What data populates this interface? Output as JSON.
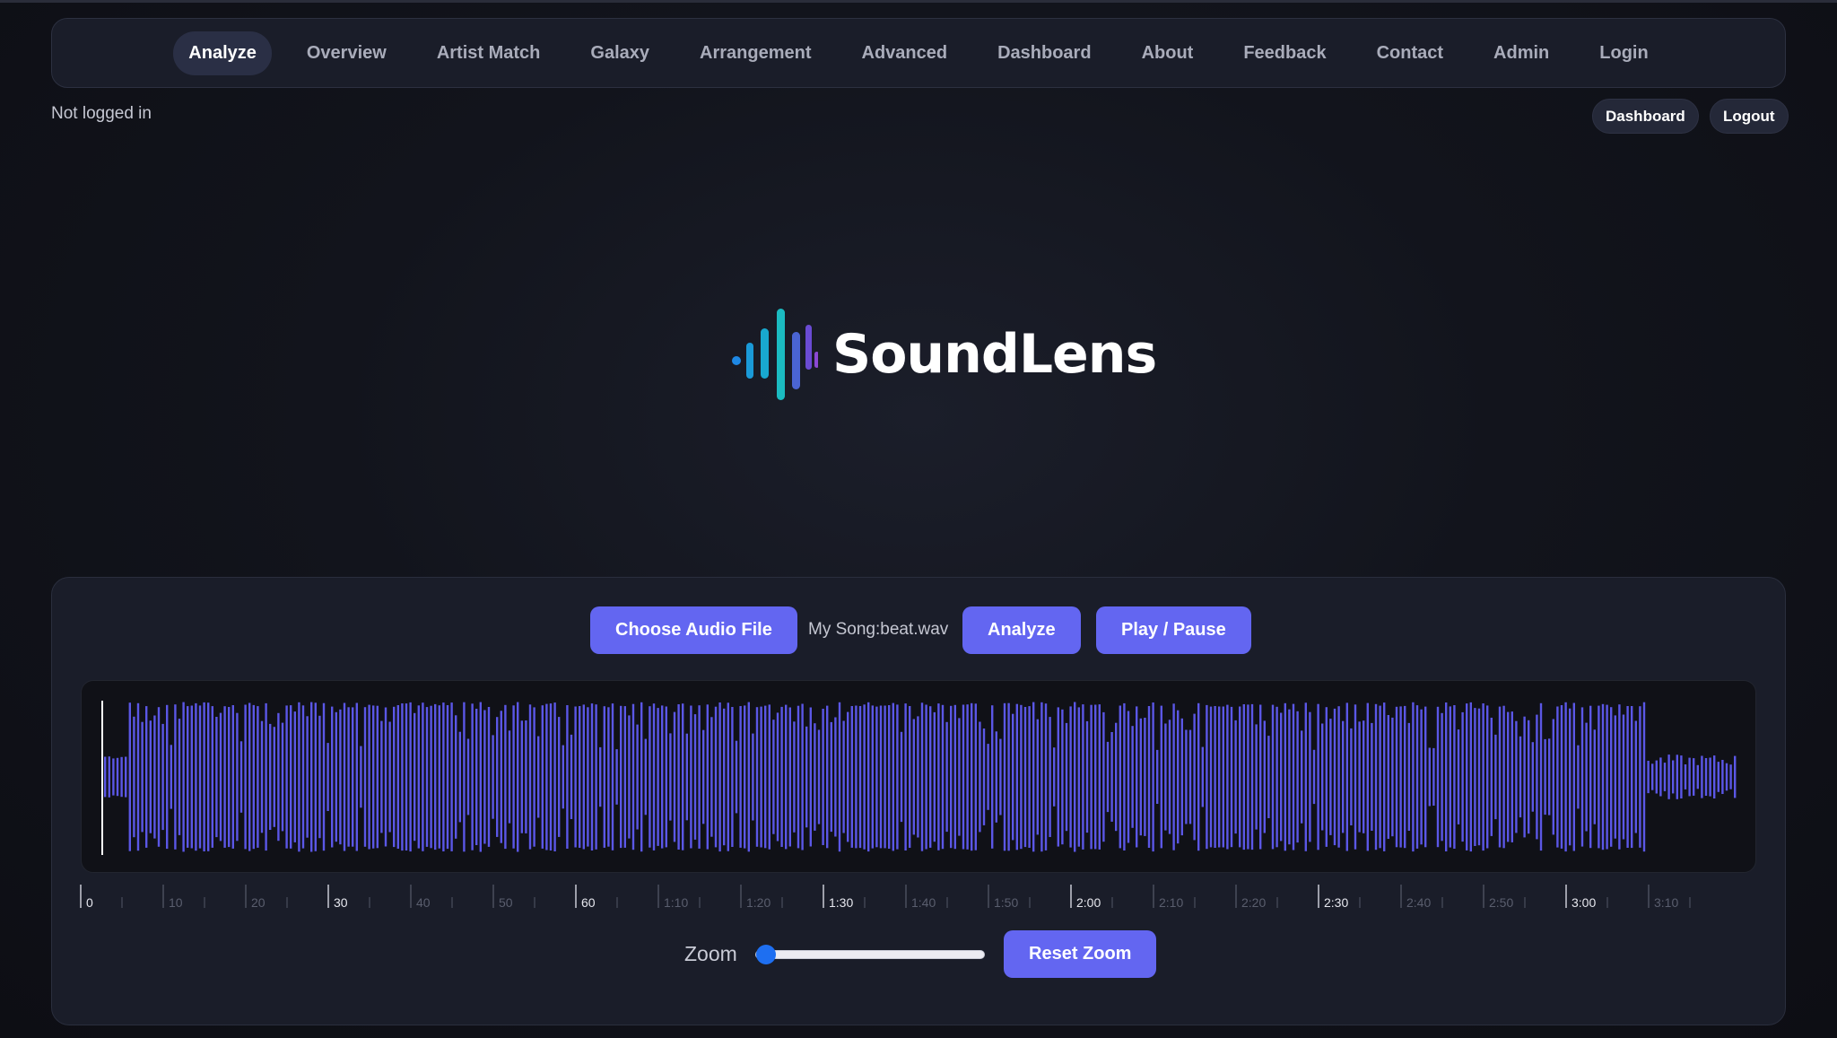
{
  "nav": {
    "items": [
      {
        "label": "Analyze",
        "active": true
      },
      {
        "label": "Overview",
        "active": false
      },
      {
        "label": "Artist Match",
        "active": false
      },
      {
        "label": "Galaxy",
        "active": false
      },
      {
        "label": "Arrangement",
        "active": false
      },
      {
        "label": "Advanced",
        "active": false
      },
      {
        "label": "Dashboard",
        "active": false
      },
      {
        "label": "About",
        "active": false
      },
      {
        "label": "Feedback",
        "active": false
      },
      {
        "label": "Contact",
        "active": false
      },
      {
        "label": "Admin",
        "active": false
      },
      {
        "label": "Login",
        "active": false
      }
    ]
  },
  "session": {
    "status": "Not logged in",
    "dashboard_label": "Dashboard",
    "logout_label": "Logout"
  },
  "brand": {
    "name": "SoundLens",
    "icon": "soundwave-logo-icon"
  },
  "player": {
    "choose_label": "Choose Audio File",
    "file_name": "My Song:beat.wav",
    "analyze_label": "Analyze",
    "play_label": "Play / Pause",
    "zoom_label": "Zoom",
    "reset_zoom_label": "Reset Zoom",
    "zoom_level": 0,
    "timeline_labels": [
      "0",
      "10",
      "20",
      "30",
      "40",
      "50",
      "60",
      "1:10",
      "1:20",
      "1:30",
      "1:40",
      "1:50",
      "2:00",
      "2:10",
      "2:20",
      "2:30",
      "2:40",
      "2:50",
      "3:00",
      "3:10"
    ],
    "major_labels": [
      "0",
      "30",
      "60",
      "1:30",
      "2:00",
      "2:30",
      "3:00"
    ]
  },
  "colors": {
    "accent": "#6366f1",
    "waveform": "#5b57e6",
    "background": "#12141c",
    "panel": "#1a1d29"
  }
}
